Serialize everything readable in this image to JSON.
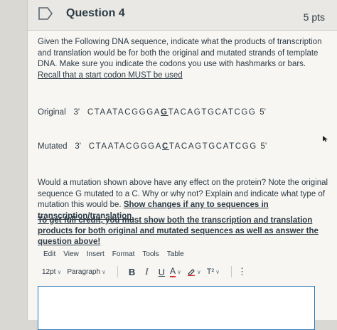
{
  "question": {
    "title": "Question 4",
    "points": "5 pts",
    "prompt_text": "Given the Following DNA sequence, indicate what the products of transcription and translation would be for both the original and mutated strands of template DNA. Make sure you indicate the codons you use with hashmarks or bars. ",
    "prompt_underlined": "Recall that a start codon MUST be used"
  },
  "sequences": {
    "original_label": "Original",
    "original_prime3": "3'",
    "original_before": "CTAATACGGGA",
    "original_mut": "G",
    "original_after": "TACAGTGCATCGG",
    "original_prime5": "5'",
    "mutated_label": "Mutated",
    "mutated_prime3": "3'",
    "mutated_before": "CTAATACGGGA",
    "mutated_mut": "C",
    "mutated_after": "TACAGTGCATCGG",
    "mutated_prime5": "5'"
  },
  "followup": {
    "text": "Would a mutation shown above have any effect on the protein? Note the original sequence G mutated to a C. Why or why not? Explain and indicate what type of mutation this would be. ",
    "bold_underlined": "Show changes if any to sequences in transcription/translation.",
    "credit": "To get full credit, you must show both the transcription and translation products for both original and mutated sequences as well as answer the question above!"
  },
  "editor": {
    "menu": [
      "Edit",
      "View",
      "Insert",
      "Format",
      "Tools",
      "Table"
    ],
    "font_size": "12pt",
    "block_format": "Paragraph",
    "bold": "B",
    "italic": "I",
    "underline": "U",
    "text_color": "A",
    "superscript": "T²",
    "more": "⋮",
    "content": ""
  }
}
